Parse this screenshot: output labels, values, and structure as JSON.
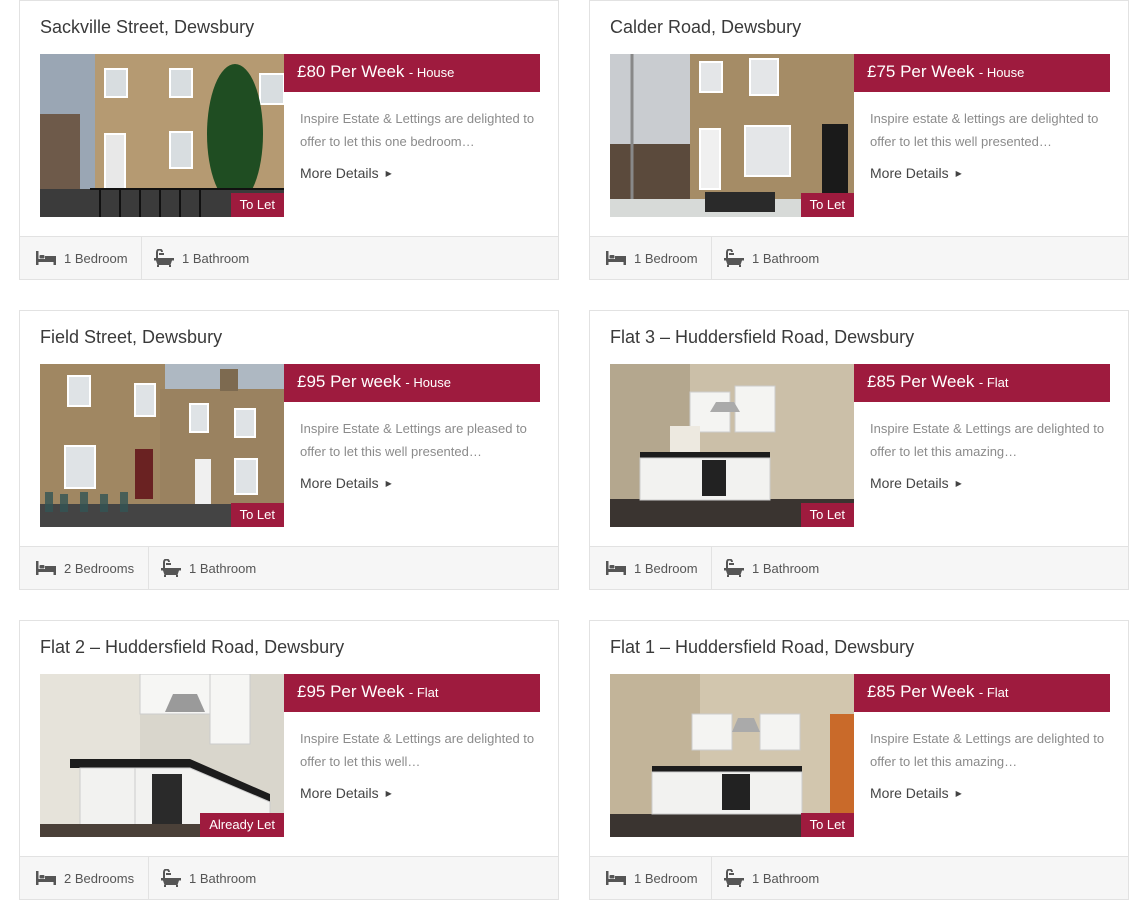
{
  "colors": {
    "accent": "#9e1b3e",
    "footer_bg": "#f6f6f6",
    "border": "#e2e2e2"
  },
  "common": {
    "more_details": "More Details"
  },
  "listings": [
    {
      "title": "Sackville Street, Dewsbury",
      "price": "£80 Per Week",
      "type": "- House",
      "description": "Inspire Estate & Lettings are delighted to offer to let this one bedroom…",
      "status": "To Let",
      "bedrooms": "1 Bedroom",
      "bathrooms": "1 Bathroom",
      "photo": "house-exterior"
    },
    {
      "title": "Calder Road, Dewsbury",
      "price": "£75 Per Week",
      "type": "- House",
      "description": "Inspire estate & lettings are delighted to offer to let this well presented…",
      "status": "To Let",
      "bedrooms": "1 Bedroom",
      "bathrooms": "1 Bathroom",
      "photo": "house-exterior"
    },
    {
      "title": "Field Street, Dewsbury",
      "price": "£95 Per week",
      "type": "- House",
      "description": "Inspire Estate & Lettings are pleased to offer to let this well presented…",
      "status": "To Let",
      "bedrooms": "2 Bedrooms",
      "bathrooms": "1 Bathroom",
      "photo": "house-exterior"
    },
    {
      "title": "Flat 3 – Huddersfield Road, Dewsbury",
      "price": "£85 Per Week",
      "type": "- Flat",
      "description": "Inspire Estate & Lettings are delighted to offer to let this amazing…",
      "status": "To Let",
      "bedrooms": "1 Bedroom",
      "bathrooms": "1 Bathroom",
      "photo": "kitchen"
    },
    {
      "title": "Flat 2 – Huddersfield Road, Dewsbury",
      "price": "£95 Per Week",
      "type": "- Flat",
      "description": "Inspire Estate & Lettings are delighted to offer to let this well…",
      "status": "Already Let",
      "bedrooms": "2 Bedrooms",
      "bathrooms": "1 Bathroom",
      "photo": "kitchen"
    },
    {
      "title": "Flat 1 – Huddersfield Road, Dewsbury",
      "price": "£85 Per Week",
      "type": "- Flat",
      "description": "Inspire Estate & Lettings are delighted to offer to let this amazing…",
      "status": "To Let",
      "bedrooms": "1 Bedroom",
      "bathrooms": "1 Bathroom",
      "photo": "kitchen"
    }
  ]
}
